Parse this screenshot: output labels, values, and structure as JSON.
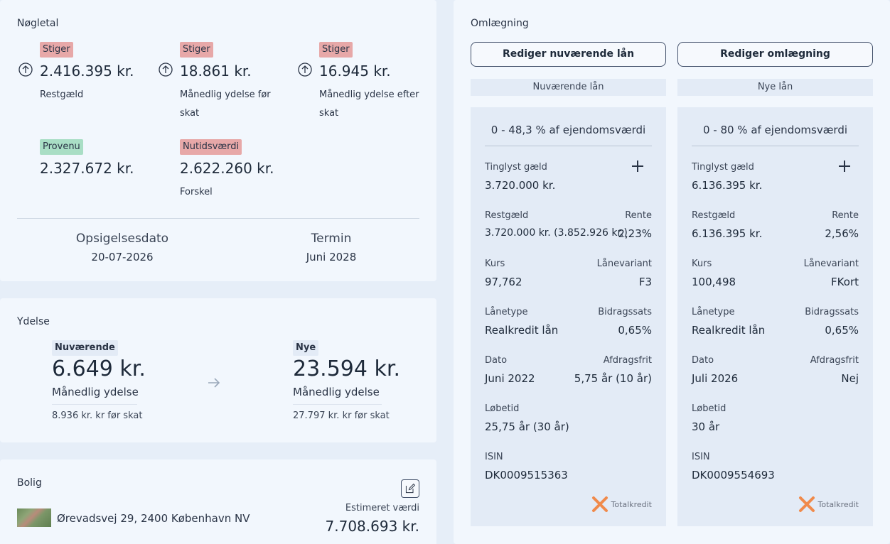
{
  "noegletal": {
    "title": "Nøgletal",
    "items": [
      {
        "badge": "Stiger",
        "value": "2.416.395 kr.",
        "label": "Restgæld"
      },
      {
        "badge": "Stiger",
        "value": "18.861 kr.",
        "label1": "Månedlig ydelse før",
        "label2": "skat"
      },
      {
        "badge": "Stiger",
        "value": "16.945 kr.",
        "label1": "Månedlig ydelse efter",
        "label2": "skat"
      },
      {
        "badge": "Provenu",
        "value": "2.327.672 kr."
      },
      {
        "badge": "Nutidsværdi",
        "value": "2.622.260 kr.",
        "label": "Forskel"
      }
    ],
    "opsigelse_label": "Opsigelsesdato",
    "opsigelse_value": "20-07-2026",
    "termin_label": "Termin",
    "termin_value": "Juni 2028"
  },
  "ydelse": {
    "title": "Ydelse",
    "current": {
      "badge": "Nuværende",
      "value": "6.649 kr.",
      "label": "Månedlig ydelse",
      "pre_tax": "8.936 kr. kr før skat"
    },
    "new": {
      "badge": "Nye",
      "value": "23.594 kr.",
      "label": "Månedlig ydelse",
      "pre_tax": "27.797 kr. kr før skat"
    }
  },
  "bolig": {
    "title": "Bolig",
    "address": "Ørevadsvej 29, 2400 København NV",
    "est_label": "Estimeret værdi",
    "est_value": "7.708.693 kr."
  },
  "omlaegning": {
    "title": "Omlægning",
    "btn_current": "Rediger nuværende lån",
    "btn_new": "Rediger omlægning",
    "col_current": "Nuværende lån",
    "col_new": "Nye lån",
    "labels": {
      "tinglyst": "Tinglyst gæld",
      "restgaeld": "Restgæld",
      "rente": "Rente",
      "kurs": "Kurs",
      "laanevariant": "Lånevariant",
      "laanetype": "Lånetype",
      "bidragssats": "Bidragssats",
      "dato": "Dato",
      "afdragsfrit": "Afdragsfrit",
      "loebetid": "Løbetid",
      "isin": "ISIN"
    },
    "lender": "Totalkredit",
    "current": {
      "range": "0 - 48,3 % af ejendomsværdi",
      "tinglyst": "3.720.000 kr.",
      "restgaeld": "3.720.000 kr. (3.852.926 kr.)",
      "rente": "2,23%",
      "kurs": "97,762",
      "laanevariant": "F3",
      "laanetype": "Realkredit lån",
      "bidragssats": "0,65%",
      "dato": "Juni 2022",
      "afdragsfrit": "5,75 år (10 år)",
      "loebetid": "25,75 år (30 år)",
      "isin": "DK0009515363"
    },
    "new": {
      "range": "0 - 80 % af ejendomsværdi",
      "tinglyst": "6.136.395 kr.",
      "restgaeld": "6.136.395 kr.",
      "rente": "2,56%",
      "kurs": "100,498",
      "laanevariant": "FKort",
      "laanetype": "Realkredit lån",
      "bidragssats": "0,65%",
      "dato": "Juli 2026",
      "afdragsfrit": "Nej",
      "loebetid": "30 år",
      "isin": "DK0009554693"
    }
  },
  "colors": {
    "stiger": "#e7a8a8",
    "provenu": "#a9dec5",
    "logo_orange": "#f08a4b"
  }
}
